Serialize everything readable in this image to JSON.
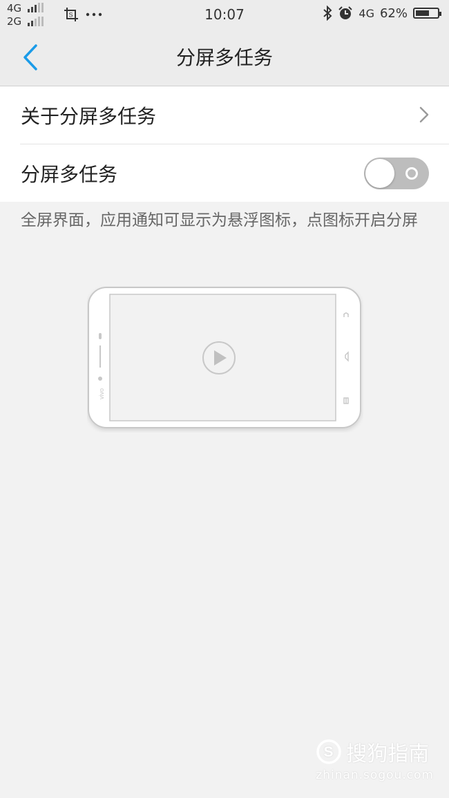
{
  "status_bar": {
    "network_top": "4G",
    "network_bottom": "2G",
    "time": "10:07",
    "network_right": "4G",
    "battery": "62%",
    "battery_level": 0.62,
    "icons": [
      "signal-icon",
      "screenshot-icon",
      "more-icon",
      "bluetooth-icon",
      "alarm-icon",
      "battery-icon"
    ]
  },
  "nav": {
    "title": "分屏多任务",
    "back_icon": "chevron-left-icon"
  },
  "list": {
    "about_label": "关于分屏多任务",
    "toggle_label": "分屏多任务",
    "toggle_on": false
  },
  "description": "全屏界面，应用通知可显示为悬浮图标，点图标开启分屏",
  "illustration": {
    "icon": "phone-landscape-play-icon",
    "brand": "vivo"
  },
  "watermark": {
    "brand": "搜狗指南",
    "url": "zhinan.sogou.com"
  },
  "colors": {
    "accent": "#1a9be8",
    "background": "#f2f2f2",
    "toggle_off": "#bdbdbd"
  }
}
